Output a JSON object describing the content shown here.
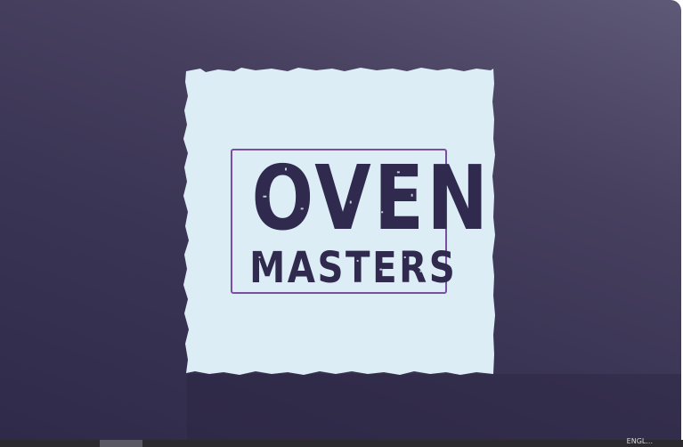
{
  "logo": {
    "line1": "OVEN",
    "line2": "MASTERS",
    "colors": {
      "ink": "#2f2a4e",
      "paper": "#ddedf6",
      "frame": "#7a4fa2"
    }
  },
  "taskbar": {
    "label": "ENGL..."
  },
  "colors": {
    "background_top": "#5e5977",
    "background_bottom": "#302a4a"
  }
}
